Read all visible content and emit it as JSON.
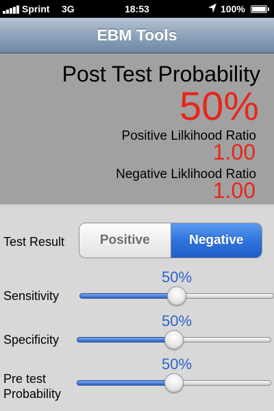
{
  "status_bar": {
    "carrier": "Sprint",
    "network": "3G",
    "time": "18:53",
    "battery": "100%",
    "battery_level": 1.0,
    "icons": [
      "signal-bars-icon",
      "location-arrow-icon",
      "battery-icon"
    ]
  },
  "navbar": {
    "title": "EBM Tools"
  },
  "results": {
    "post_test_label": "Post Test Probability",
    "post_test_value": "50%",
    "plr_label": "Positive Lilkihood Ratio",
    "plr_value": "1.00",
    "nlr_label": "Negative Liklihood Ratio",
    "nlr_value": "1.00",
    "value_color": "#e8261c"
  },
  "controls": {
    "test_result": {
      "label": "Test Result",
      "options": [
        "Positive",
        "Negative"
      ],
      "selected": "Negative"
    },
    "sensitivity": {
      "label": "Sensitivity",
      "value_text": "50%",
      "value": 0.5
    },
    "specificity": {
      "label": "Specificity",
      "value_text": "50%",
      "value": 0.5
    },
    "pretest": {
      "label_line1": "Pre test",
      "label_line2": "Probability",
      "value_text": "50%",
      "value": 0.5
    }
  },
  "colors": {
    "accent": "#2f74dc",
    "percent_text": "#2f63c8"
  }
}
